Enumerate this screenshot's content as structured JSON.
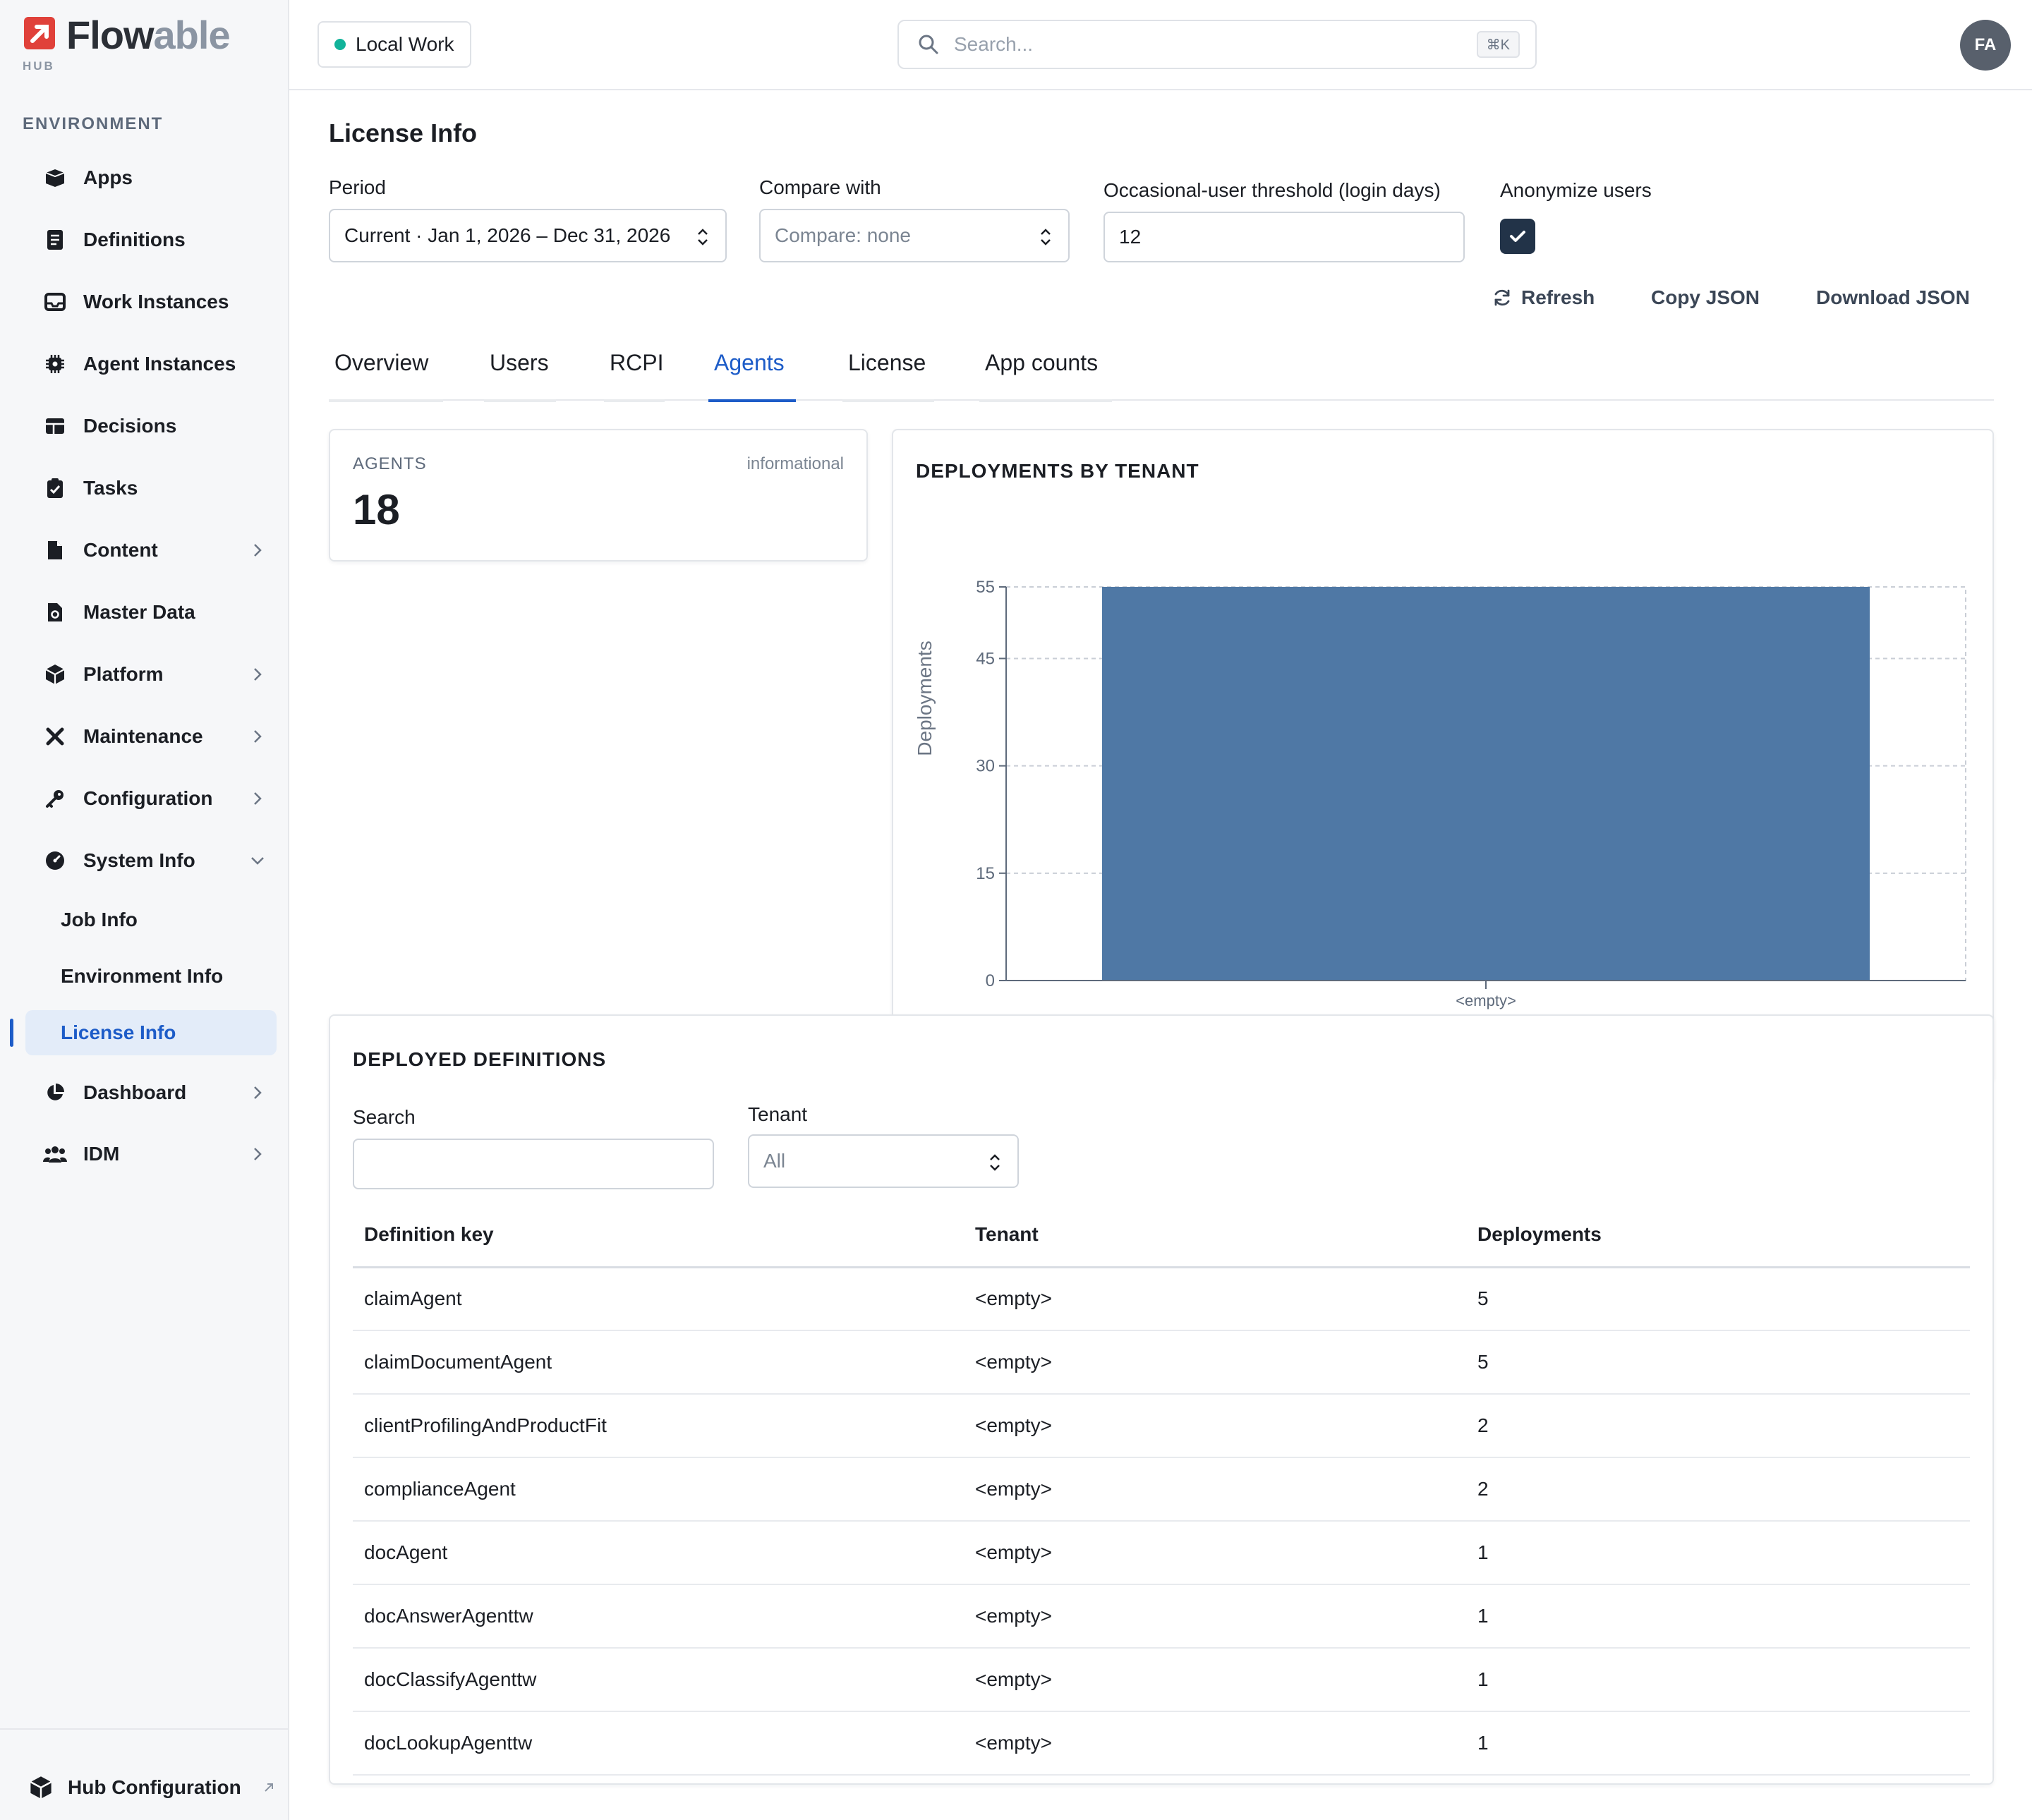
{
  "app": {
    "logo_text_main": "Flow",
    "logo_text_accent": "able",
    "logo_sub": "HUB"
  },
  "sidebar": {
    "section_label": "ENVIRONMENT",
    "items": [
      {
        "label": "Apps",
        "icon": "box-icon"
      },
      {
        "label": "Definitions",
        "icon": "document-icon"
      },
      {
        "label": "Work Instances",
        "icon": "inbox-icon"
      },
      {
        "label": "Agent Instances",
        "icon": "chip-icon"
      },
      {
        "label": "Decisions",
        "icon": "table-icon"
      },
      {
        "label": "Tasks",
        "icon": "clipboard-check-icon"
      },
      {
        "label": "Content",
        "icon": "file-icon"
      },
      {
        "label": "Master Data",
        "icon": "file-cog-icon"
      },
      {
        "label": "Platform",
        "icon": "cube-icon"
      },
      {
        "label": "Maintenance",
        "icon": "tools-icon"
      },
      {
        "label": "Configuration",
        "icon": "key-icon"
      },
      {
        "label": "System Info",
        "icon": "gauge-icon"
      },
      {
        "label": "Dashboard",
        "icon": "pie-chart-icon"
      },
      {
        "label": "IDM",
        "icon": "users-icon"
      }
    ],
    "system_info_sub": [
      {
        "label": "Job Info"
      },
      {
        "label": "Environment Info"
      },
      {
        "label": "License Info"
      }
    ],
    "footer_label": "Hub Configuration"
  },
  "topbar": {
    "environment": "Local Work",
    "search_placeholder": "Search...",
    "search_shortcut": "⌘K",
    "avatar_initials": "FA"
  },
  "page": {
    "title": "License Info",
    "period_label": "Period",
    "period_value": "Current · Jan 1, 2026 – Dec 31, 2026",
    "compare_label": "Compare with",
    "compare_value": "Compare: none",
    "threshold_label": "Occasional-user threshold (login days)",
    "threshold_value": "12",
    "anonymize_label": "Anonymize users",
    "anonymize_checked": true,
    "actions": {
      "refresh": "Refresh",
      "copy": "Copy JSON",
      "download": "Download JSON"
    },
    "tabs": [
      "Overview",
      "Users",
      "RCPI",
      "Agents",
      "License",
      "App counts"
    ],
    "active_tab": "Agents"
  },
  "agents_card": {
    "caption": "AGENTS",
    "badge": "informational",
    "value": "18"
  },
  "chart_data": {
    "type": "bar",
    "title": "DEPLOYMENTS BY TENANT",
    "categories": [
      "<empty>"
    ],
    "values": [
      55
    ],
    "xlabel": "",
    "ylabel": "Deployments",
    "ylim": [
      0,
      55
    ],
    "yticks": [
      0,
      15,
      30,
      45,
      55
    ],
    "grid": true,
    "bar_color": "#4f78a5"
  },
  "definitions": {
    "title": "DEPLOYED DEFINITIONS",
    "search_label": "Search",
    "search_value": "",
    "tenant_label": "Tenant",
    "tenant_value": "All",
    "columns": [
      "Definition key",
      "Tenant",
      "Deployments"
    ],
    "rows": [
      [
        "claimAgent",
        "<empty>",
        "5"
      ],
      [
        "claimDocumentAgent",
        "<empty>",
        "5"
      ],
      [
        "clientProfilingAndProductFit",
        "<empty>",
        "2"
      ],
      [
        "complianceAgent",
        "<empty>",
        "2"
      ],
      [
        "docAgent",
        "<empty>",
        "1"
      ],
      [
        "docAnswerAgenttw",
        "<empty>",
        "1"
      ],
      [
        "docClassifyAgenttw",
        "<empty>",
        "1"
      ],
      [
        "docLookupAgenttw",
        "<empty>",
        "1"
      ]
    ]
  }
}
